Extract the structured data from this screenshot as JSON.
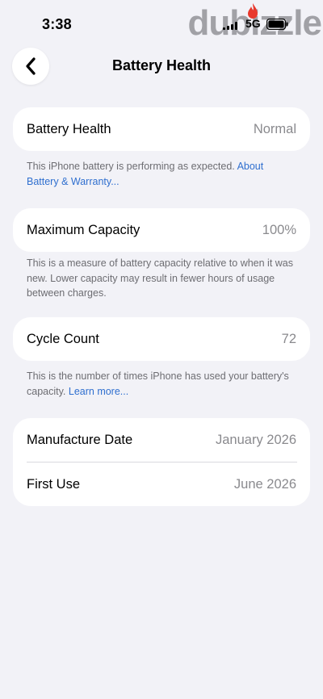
{
  "status_bar": {
    "time": "3:38",
    "network": "5G",
    "watermark": "dubizzle"
  },
  "nav": {
    "back_icon": "chevron-left-icon",
    "title": "Battery Health"
  },
  "battery_health": {
    "label": "Battery Health",
    "value": "Normal",
    "footnote_text": "This iPhone battery is performing as expected. ",
    "footnote_link": "About Battery & Warranty..."
  },
  "maximum_capacity": {
    "label": "Maximum Capacity",
    "value": "100%",
    "footnote_text": "This is a measure of battery capacity relative to when it was new. Lower capacity may result in fewer hours of usage between charges."
  },
  "cycle_count": {
    "label": "Cycle Count",
    "value": "72",
    "footnote_text": "This is the number of times iPhone has used your battery's capacity. ",
    "footnote_link": "Learn more..."
  },
  "dates": {
    "manufacture_label": "Manufacture Date",
    "manufacture_value": "January 2026",
    "first_use_label": "First Use",
    "first_use_value": "June 2026"
  },
  "colors": {
    "background": "#f2f2f7",
    "link": "#2f6fcf",
    "secondary_text": "#8a8a8e"
  }
}
